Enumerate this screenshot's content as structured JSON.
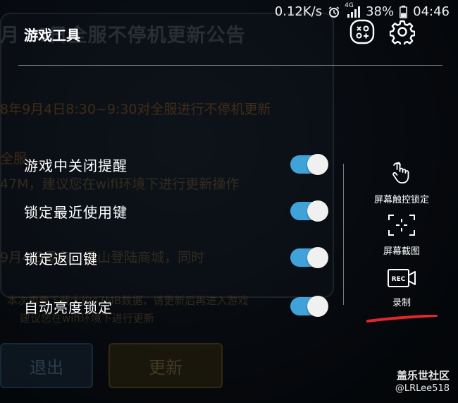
{
  "status_bar": {
    "net_speed": "0.12K/s",
    "network": "4G",
    "battery": "38%",
    "time": "04:46"
  },
  "background": {
    "announcement_title": "4日全服不停机更新公告",
    "announcement_title_prefix": "月",
    "lines": [
      "8年9月4日8:30~9:30对全服进行不停机更新",
      "全服",
      "47M，建议您在wifi环境下进行更新操作",
      "9月4日零点，盾山登陆商城，同时",
      "本次需要下载大约47MB数据，请更新后再进入游戏",
      "建议您在wifi环境下进行更新"
    ],
    "exit_button": "退出",
    "update_button": "更新"
  },
  "game_tools": {
    "title": "游戏工具",
    "settings": [
      {
        "label": "游戏中关闭提醒",
        "enabled": true
      },
      {
        "label": "锁定最近使用键",
        "enabled": true
      },
      {
        "label": "锁定返回键",
        "enabled": true
      },
      {
        "label": "自动亮度锁定",
        "enabled": true
      }
    ],
    "tools": [
      {
        "label": "屏幕触控锁定",
        "icon": "touch-lock-icon"
      },
      {
        "label": "屏幕截图",
        "icon": "screenshot-icon"
      },
      {
        "label": "录制",
        "icon": "rec-icon"
      }
    ]
  },
  "watermark": {
    "site": "盖乐世社区",
    "user": "@LRLee518"
  },
  "colors": {
    "toggle_on": "#3fa2d8",
    "annotation_underline": "#e0282c"
  }
}
